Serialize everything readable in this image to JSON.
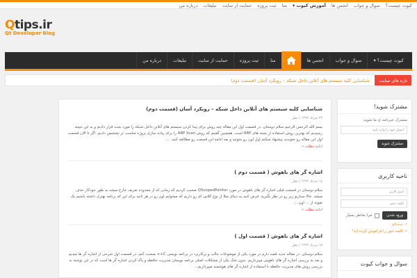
{
  "topbar": {
    "items": [
      "کیوت چیست؟",
      "سوال و جواب",
      "انجمن ها",
      "آموزش کیوت ▾",
      "متا",
      "ثبت پروژه",
      "حمایت از سایت",
      "تبلیغات",
      "درباره من"
    ],
    "active_index": 3
  },
  "logo": {
    "main_q": "Q",
    "main_rest": "tips.ir",
    "sub": "Qt Developer Blog"
  },
  "nav": {
    "home_icon": "home-icon",
    "items": [
      "کیوت چیست؟ ▾",
      "سوال و جواب",
      "انجمن ها",
      "آموزش کیوت ▾",
      "متا",
      "ثبت پروژه",
      "حمایت از سایت",
      "تبلیغات",
      "درباره من"
    ]
  },
  "ticker": {
    "label": "تازه های سایت",
    "text": "شناسایی کلیه سیستم های آنلاین داخل شبکه – رویکرد آسان (قسمت دوم)"
  },
  "posts": [
    {
      "title": "شناسایی کلیه سیستم های آنلاین داخل شبکه – رویکرد آسان (قسمت دوم)",
      "meta": "۲۳ مرداد ۱۳۹۲ | نظر",
      "excerpt": "بسم الله الرحمن الرحیم سلام دوستان. در قسمت اول این مقاله چند روش برای پیدا کردن سیستم های آنلاین داخل شبکه را مورد بحث قرار دادیم و به این نتیجه رسیدیم که بهترین روش استفاده از بسته های ARP است. همچنین گفتیم که روش ARP Scan را برای پیاده سازی پروژه مناسب تر تشخیص دادیم. اگر تا الان قسمت اول این مقاله رو نخوندید پیشنهاد میکنم اول اون رو بخونید و بعد ادامه این قسمت رو مطالعه کنید. ...",
      "more": "ادامه مطلب »"
    },
    {
      "title": "اشاره گر های باهوش ( قسمت دوم )",
      "meta": "۱۸ مرداد ۱۳۹۲ | نظر",
      "excerpt": "سلام دوستان در قسمت قبلی اشاره گر های باهوش در مورد QScopedPointer صحبت کردیم که زمانی که از محدوده تعریف خارج میشد به طور خودکار حذف میشد. حالا سناریو زیر رو در نظر بگیرید: فرض کنید یه دیتای مثلا از نوع کلاس ای رو داریم که میخوایم اون رو در هر ثانیه برای این که برنامه بهتری داشته باشیم یک نمونه از ... اون ...",
      "more": "ادامه مطلب »"
    },
    {
      "title": "اشاره گر های باهوش ( قسمت اول )",
      "meta": "۱۵ مرداد ۱۳۹۲ | نظر",
      "excerpt": "سلام دوستان. در مقاله جدید قصد دارم در مورد یکی از موضوعات جالب و پرکاربرد در برنامه نویسی C++ صحبت کنم. در قسمت اول شرحی از اشاره گر ها میدیم و بعد به بررسی اشاره گر های باهوش میپردازیم. بدون شک یکی از مشکلات اصلی برنامه نویسان مدیریت حافظه و پاک کردن اشاره گر ها است که در این نوشته به بررسی روش های مدیریت حافظه با استفاده از اشاره گر های هوشمند میپردازیم..."
    }
  ],
  "sidebar": {
    "subscribe": {
      "title": "مشترک شوید!",
      "text": "مشترک خبرنامه ی ما شوید:",
      "email_placeholder": "ایمیل خود را وارد کنید",
      "button": "مشترک شوید"
    },
    "user": {
      "title": "ناحیه کاربری",
      "username_placeholder": "اسم کاربر",
      "password_placeholder": "کلمه عبور",
      "remember": "مرا بخاطر بسپار",
      "login_button": "ورود شدن",
      "links": [
        "ثبت‌نام",
        "کلمه عبور را فراموش کرده اید؟"
      ]
    },
    "qa": {
      "title": "سوال و جواب کیوت"
    }
  },
  "colors": {
    "accent": "#f88c00",
    "nav_bg": "#2b2b2b",
    "ticker_label": "#f44336"
  }
}
